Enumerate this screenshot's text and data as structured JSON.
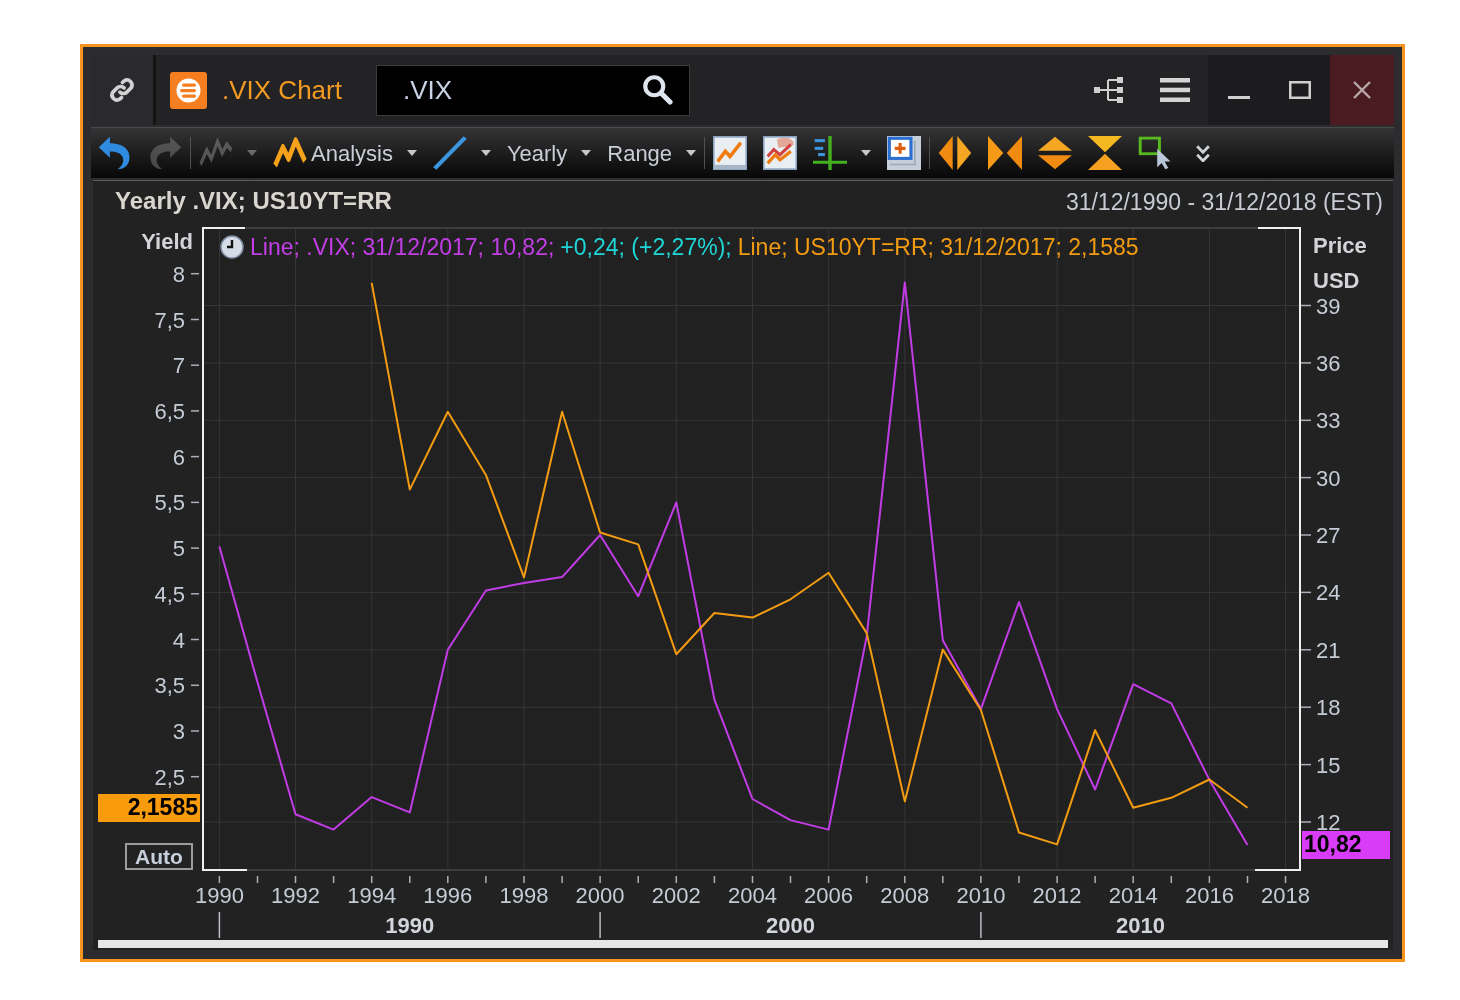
{
  "window": {
    "title": ".VIX Chart",
    "search": {
      "value": ".VIX"
    }
  },
  "toolbar": [
    [
      {
        "kind": "button",
        "disabled": false
      },
      {
        "kind": "button",
        "disabled": true
      }
    ],
    [
      {
        "kind": "dropdown",
        "disabled": true
      },
      {
        "kind": "dropdown",
        "label": "Analysis",
        "disabled": false
      },
      {
        "kind": "dropdown",
        "disabled": false
      },
      {
        "kind": "dropdown",
        "label": "Yearly",
        "disabled": false
      },
      {
        "kind": "dropdown",
        "label": "Range",
        "disabled": false
      }
    ],
    [
      {
        "kind": "button",
        "disabled": false
      },
      {
        "kind": "button",
        "disabled": false
      },
      {
        "kind": "dropdown",
        "disabled": false
      },
      {
        "kind": "button",
        "disabled": false
      }
    ],
    [
      {
        "kind": "button",
        "disabled": false
      },
      {
        "kind": "button",
        "disabled": false
      },
      {
        "kind": "button",
        "disabled": false
      },
      {
        "kind": "button",
        "disabled": false
      },
      {
        "kind": "button",
        "disabled": false
      },
      {
        "kind": "button",
        "disabled": false
      }
    ]
  ],
  "chart": {
    "heading": "Yearly .VIX; US10YT=RR",
    "period": "31/12/1990 - 31/12/2018 (EST)",
    "legend": [
      {
        "text": "Line; .VIX; 31/12/2017; 10,82;",
        "color": "#c43ee8"
      },
      {
        "text": "+0,24; (+2,27%);",
        "color": "#1fd6d6"
      },
      {
        "text": "Line; US10YT=RR; 31/12/2017; 2,1585",
        "color": "#f39c12"
      }
    ],
    "scale_button": "Auto",
    "last_values": [
      {
        "kind": "left",
        "text": "2,1585",
        "color": "#f89c0e"
      },
      {
        "kind": "right",
        "text": "10,82",
        "color": "#d93cf7"
      }
    ],
    "chart_data": {
      "type": "line",
      "ylabel": "Yield",
      "y2label": "Price USD",
      "grid": true,
      "x": [
        1990,
        1991,
        1992,
        1993,
        1994,
        1995,
        1996,
        1997,
        1998,
        1999,
        2000,
        2001,
        2002,
        2003,
        2004,
        2005,
        2006,
        2007,
        2008,
        2009,
        2010,
        2011,
        2012,
        2013,
        2014,
        2015,
        2016,
        2017
      ],
      "series": [
        {
          "color": "#c23ce6",
          "axis": "y2",
          "values": [
            26.4,
            19.3,
            12.4,
            11.6,
            13.3,
            12.5,
            21.0,
            24.1,
            24.5,
            24.8,
            27.0,
            23.8,
            28.7,
            18.4,
            13.2,
            12.1,
            11.6,
            21.7,
            40.2,
            21.5,
            17.9,
            23.5,
            17.9,
            13.7,
            19.2,
            18.2,
            14.2,
            10.8
          ]
        },
        {
          "color": "#f39c12",
          "values": [
            null,
            null,
            null,
            null,
            7.9,
            5.64,
            6.49,
            5.8,
            4.68,
            6.49,
            5.17,
            5.04,
            3.84,
            4.29,
            4.24,
            4.44,
            4.73,
            4.07,
            2.23,
            3.89,
            3.23,
            1.89,
            1.76,
            3.01,
            2.16,
            2.27,
            2.47,
            2.16
          ]
        }
      ],
      "xlim": [
        1989.57,
        2018.38
      ],
      "ylim": [
        1.48,
        8.5
      ],
      "y2lim": [
        9.49,
        43.05
      ],
      "xticks": [
        1990,
        1992,
        1994,
        1996,
        1998,
        2000,
        2002,
        2004,
        2006,
        2008,
        2010,
        2012,
        2014,
        2016,
        2018
      ],
      "yticks": [
        {
          "value": 2.5,
          "label": "2,5"
        },
        3,
        {
          "value": 3.5,
          "label": "3,5"
        },
        4,
        {
          "value": 4.5,
          "label": "4,5"
        },
        5,
        {
          "value": 5.5,
          "label": "5,5"
        },
        6,
        {
          "value": 6.5,
          "label": "6,5"
        },
        7,
        {
          "value": 7.5,
          "label": "7,5"
        },
        8
      ],
      "y2ticks": [
        12,
        15,
        18,
        21,
        24,
        27,
        30,
        33,
        36,
        39
      ],
      "annotations": [
        "1990",
        "2000",
        "2010"
      ]
    }
  }
}
